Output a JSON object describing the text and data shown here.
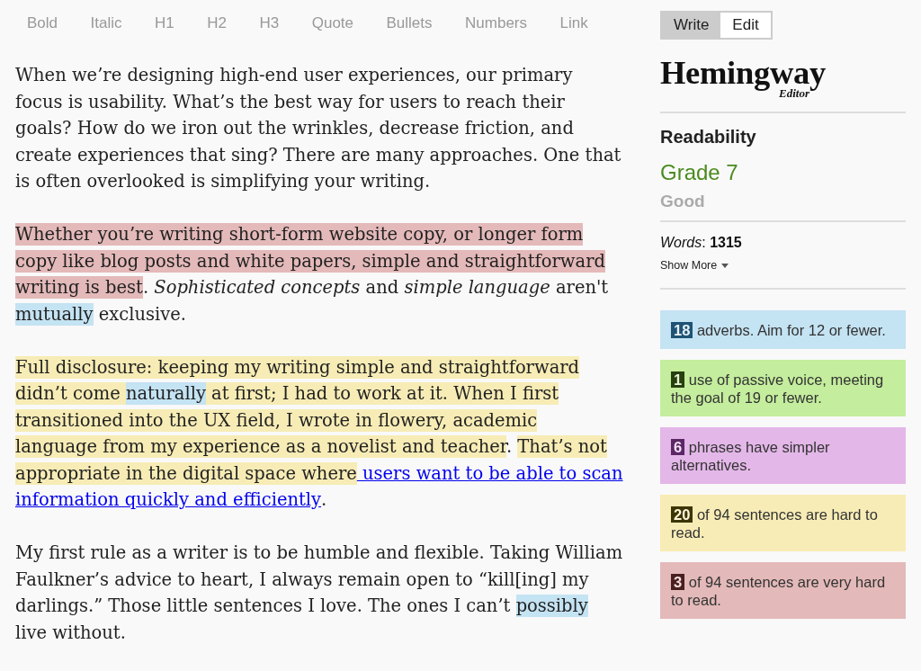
{
  "toolbar": {
    "buttons": [
      "Bold",
      "Italic",
      "H1",
      "H2",
      "H3",
      "Quote",
      "Bullets",
      "Numbers",
      "Link"
    ]
  },
  "editor": {
    "paragraphs": [
      {
        "segments": [
          {
            "kind": "text",
            "text": "When we’re designing high-end user experiences, our primary focus is usability. What’s the best way for users to reach their goals? How do we iron out the wrinkles, decrease friction, and create experiences that sing? There are many approaches. One that is often overlooked is simplifying your writing."
          }
        ]
      },
      {
        "segments": [
          {
            "kind": "very_hard",
            "text": "Whether you’re writing short-form website copy, or longer form copy like blog posts and white papers, simple and straightforward writing is best"
          },
          {
            "kind": "text",
            "text": ". *Sophisticated concepts* and *simple language* aren't "
          },
          {
            "kind": "adverb",
            "text": "mutually"
          },
          {
            "kind": "text",
            "text": " exclusive."
          }
        ]
      },
      {
        "segments": [
          {
            "kind": "hard",
            "text": "Full disclosure: keeping my writing simple and straightforward didn’t come "
          },
          {
            "kind": "adverb",
            "text": "naturally"
          },
          {
            "kind": "hard",
            "text": " at first; I had to work at it. "
          },
          {
            "kind": "hard",
            "text": "When I first transitioned into the UX field, I wrote in flowery, academic language from my experience as a novelist and teacher"
          },
          {
            "kind": "text",
            "text": ". "
          },
          {
            "kind": "hard",
            "text": "That’s not appropriate in the digital space where"
          },
          {
            "kind": "link",
            "text": " users want to be able to scan"
          },
          {
            "kind": "link",
            "text": "information quickly and efficiently"
          },
          {
            "kind": "text",
            "text": "."
          }
        ]
      },
      {
        "segments": [
          {
            "kind": "text",
            "text": "My first rule as a writer is to be humble and flexible. Taking William Faulkner’s advice to heart, I always remain open to “kill[ing] my darlings.” Those little sentences I love. The ones I can’t "
          },
          {
            "kind": "adverb",
            "text": "possibly"
          },
          {
            "kind": "text",
            "text": " live without."
          }
        ]
      }
    ]
  },
  "sidebar": {
    "mode_tabs": [
      {
        "label": "Write",
        "selected": true
      },
      {
        "label": "Edit",
        "selected": false
      }
    ],
    "logo": {
      "name": "Hemingway",
      "subtitle": "Editor"
    },
    "readability": {
      "heading": "Readability",
      "grade": "Grade 7",
      "rating": "Good"
    },
    "words": "*Words*: **1315**",
    "show_more": "Show More",
    "stats": [
      {
        "kind": "adverb",
        "count": "18",
        "text": "adverbs. Aim for 12 or fewer."
      },
      {
        "kind": "passive",
        "count": "1",
        "text": "use of passive voice, meeting the goal of 19 or fewer."
      },
      {
        "kind": "simpler",
        "count": "6",
        "text": "phrases have simpler alternatives."
      },
      {
        "kind": "hard",
        "count": "20",
        "text": "of 94 sentences are hard to read."
      },
      {
        "kind": "very_hard",
        "count": "3",
        "text": "of 94 sentences are very hard to read."
      }
    ]
  }
}
